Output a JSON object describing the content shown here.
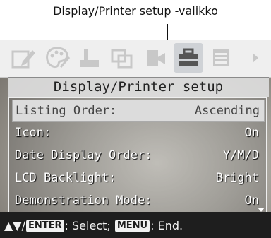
{
  "callout": {
    "text": "Display/Printer setup -valikko"
  },
  "tabs": [
    {
      "icon": "edit-icon",
      "active": false
    },
    {
      "icon": "palette-icon",
      "active": false
    },
    {
      "icon": "print-icon",
      "active": false
    },
    {
      "icon": "copy-icon",
      "active": false
    },
    {
      "icon": "card-icon",
      "active": false
    },
    {
      "icon": "toolbox-icon",
      "active": true
    },
    {
      "icon": "list-icon",
      "active": false
    }
  ],
  "menu": {
    "title": "Display/Printer setup",
    "items": [
      {
        "label": "Listing Order:",
        "value": "Ascending",
        "selected": true
      },
      {
        "label": "Icon:",
        "value": "On",
        "selected": false
      },
      {
        "label": "Date Display Order:",
        "value": "Y/M/D",
        "selected": false
      },
      {
        "label": "LCD Backlight:",
        "value": "Bright",
        "selected": false
      },
      {
        "label": "Demonstration Mode:",
        "value": "On",
        "selected": false
      }
    ]
  },
  "statusbar": {
    "arrows": "▲▼/",
    "enter_key": "ENTER",
    "select_text": ": Select; ",
    "menu_key": "MENU",
    "end_text": ": End."
  }
}
